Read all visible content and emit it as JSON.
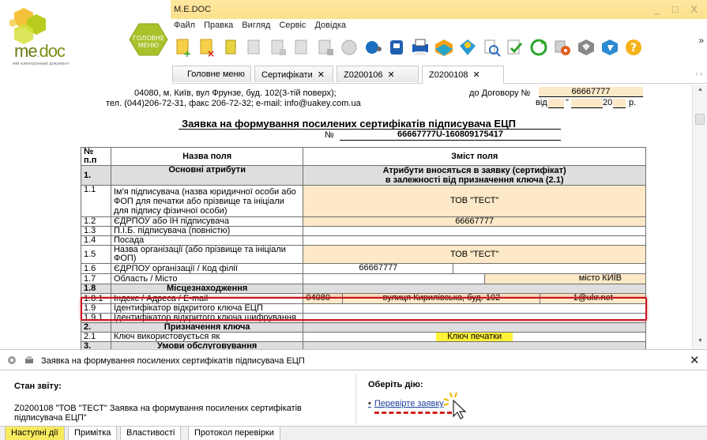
{
  "app": {
    "title": "M.E.DOC",
    "window_controls": "_ □ X",
    "logo_text_me": "me",
    "logo_text_doc": "doc",
    "logo_sub": "мій електронний документ",
    "home_button": "ГОЛОВНЕ МЕНЮ",
    "colors": {
      "title_bar": "#fbe08c",
      "logo_green": "#b5c81c",
      "field_fill": "#fde9c7",
      "highlight": "#c8141e",
      "active_tab": "#f7ea5f"
    }
  },
  "menu": [
    "Файл",
    "Правка",
    "Вигляд",
    "Сервіс",
    "Довідка"
  ],
  "toolbar_icons": [
    "new-document-icon",
    "delete-document-icon",
    "copy-icon",
    "print-preview-icon",
    "add-row-icon",
    "remove-row-icon",
    "import-icon",
    "certificate-icon",
    "xml-icon",
    "export-icon",
    "send-icon",
    "sign-icon",
    "search-icon",
    "check-icon",
    "refresh-icon",
    "sign-multiple-icon",
    "shield-icon",
    "mail-icon",
    "help-icon"
  ],
  "toolbar_more": "»",
  "tabs": [
    {
      "label": "Головне меню",
      "close": ""
    },
    {
      "label": "Сертифікати",
      "close": "✕"
    },
    {
      "label": "Z0200106",
      "close": "✕"
    },
    {
      "label": "Z0200108",
      "close": "✕"
    }
  ],
  "tab_scroll": "‹ ›",
  "doc": {
    "address_line1": "04080, м. Київ, вул Фрунзе, буд. 102(3-тій поверх);",
    "address_line2": "тел. (044)206-72-31,  факс 206-72-32; e-mail: info@uakey.com.ua",
    "contract_label": "до Договору №",
    "contract_no": "66667777",
    "vid_label": "від \"",
    "vid_quote": "\"",
    "vid_year": "20",
    "vid_r": "р.",
    "title": "Заявка на формування посилених сертифікатів підписувача ЕЦП",
    "number_label": "№",
    "number_value": "66667777U-160809175417",
    "header": {
      "col1": "№ п.п",
      "col2": "Назва поля",
      "col3": "Зміст поля"
    },
    "section1": {
      "no": "1.",
      "name": "Основні атрибути",
      "content1": "Атрибути вносяться в заявку (сертифікат)",
      "content2": "в залежності від призначення ключа (2.1)"
    },
    "row_1_1": {
      "no": "1.1",
      "name": "Ім'я підписувача (назва юридичної особи або ФОП для печатки або прізвище та ініціали для підпису фізичної особи)",
      "value": "ТОВ \"ТЕСТ\""
    },
    "row_1_2": {
      "no": "1.2",
      "name": "ЄДРПОУ або ІН підписувача",
      "value": "66667777"
    },
    "row_1_3": {
      "no": "1.3",
      "name": "П.І.Б. підписувача (повністю)",
      "value": ""
    },
    "row_1_4": {
      "no": "1.4",
      "name": "Посада",
      "value": ""
    },
    "row_1_5": {
      "no": "1.5",
      "name": "Назва організації (або прізвище та ініціали ФОП)",
      "value": "ТОВ \"ТЕСТ\""
    },
    "row_1_6": {
      "no": "1.6",
      "name": "ЄДРПОУ організації / Код філії",
      "value_a": "66667777",
      "value_b": ""
    },
    "row_1_7": {
      "no": "1.7",
      "name": "Область / Місто",
      "value_a": "",
      "value_b": "місто КИЇВ"
    },
    "section_1_8": {
      "no": "1.8",
      "name": "Місцезнаходження"
    },
    "row_1_8_1": {
      "no": "1.8.1",
      "name": "Індекс / Адреса / E-mail",
      "index": "04080",
      "address": "вулиця Кирилівська, буд. 102",
      "email": "1@ukr.net"
    },
    "row_1_9": {
      "no": "1.9",
      "name": "Ідентифікатор відкритого ключа ЕЦП",
      "value": ""
    },
    "row_1_9_1": {
      "no": "1.9.1",
      "name": "Ідентифікатор відкритого ключа шифрування",
      "value": ""
    },
    "section2": {
      "no": "2.",
      "name": "Призначення ключа"
    },
    "row_2_1": {
      "no": "2.1",
      "name": "Ключ використовується як",
      "value": "Ключ печатки"
    },
    "section3": {
      "no": "3.",
      "name": "Умови обслуговування"
    }
  },
  "scrollbar": {
    "up": "▲",
    "down": "▼"
  },
  "infobar": {
    "text": "Заявка на формування посилених сертифікатів підписувача ЕЦП",
    "close": "✕"
  },
  "status": {
    "title": "Стан звіту:",
    "text": "Z0200108 \"ТОВ \"ТЕСТ\" Заявка на формування посилених сертифікатів підписувача ЕЦП\""
  },
  "action": {
    "title": "Оберіть дію:",
    "bullet": "•",
    "link": "Перевірте заявку"
  },
  "bottom_tabs": [
    "Наступні дії",
    "Примітка",
    "Властивості",
    "Протокол перевірки"
  ]
}
